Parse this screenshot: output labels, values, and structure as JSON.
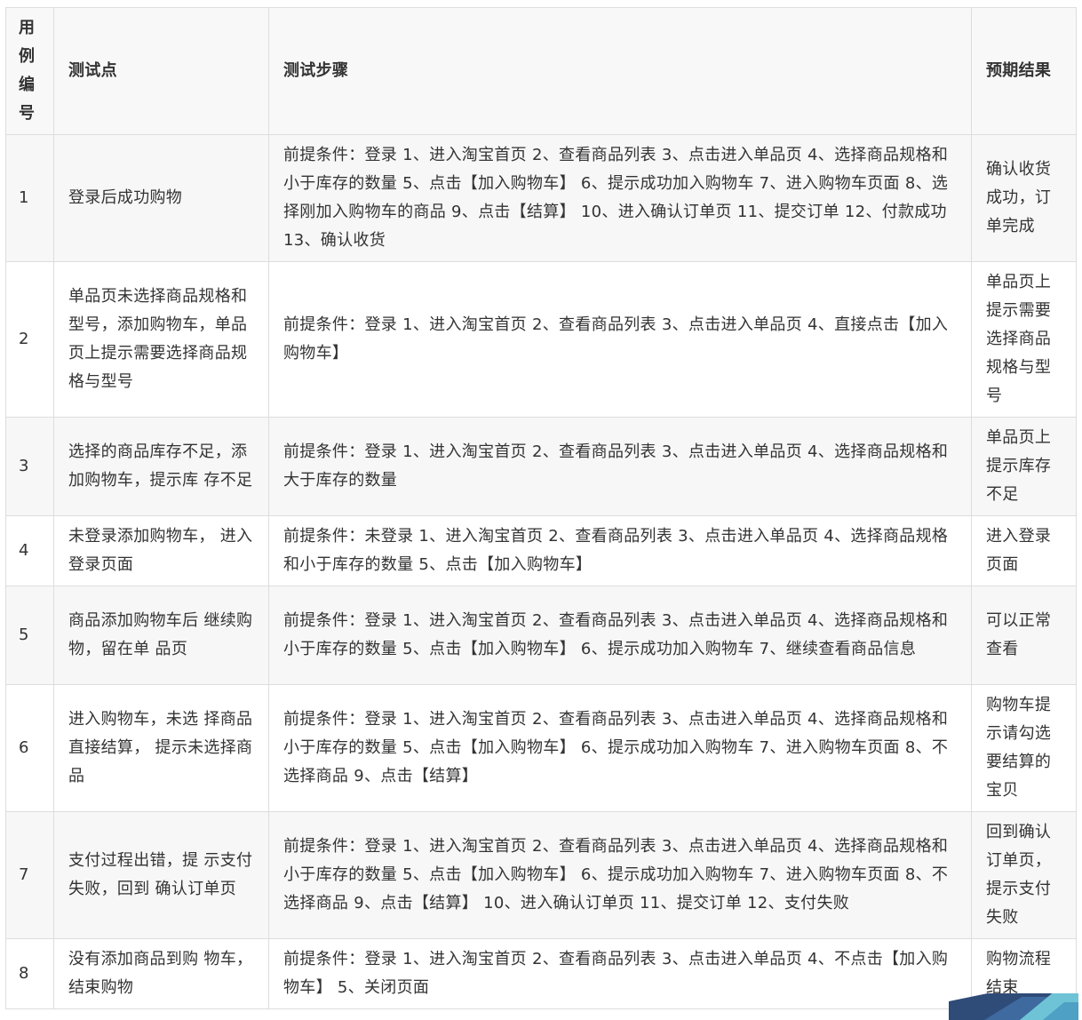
{
  "table": {
    "headers": {
      "id": "用例编号",
      "point": "测试点",
      "steps": "测试步骤",
      "result": "预期结果"
    },
    "rows": [
      {
        "id": "1",
        "point": "登录后成功购物",
        "steps": "前提条件：登录 1、进入淘宝首页 2、查看商品列表 3、点击进入单品页 4、选择商品规格和小于库存的数量 5、点击【加入购物车】 6、提示成功加入购物车 7、进入购物车页面 8、选择刚加入购物车的商品 9、点击【结算】 10、进入确认订单页 11、提交订单 12、付款成功 13、确认收货",
        "result": "确认收货成功，订单完成"
      },
      {
        "id": "2",
        "point": "单品页未选择商品规格和型号，添加购物车，单品页上提示需要选择商品规格与型号",
        "steps": "前提条件：登录 1、进入淘宝首页 2、查看商品列表 3、点击进入单品页 4、直接点击【加入购物车】",
        "result": "单品页上提示需要选择商品规格与型号"
      },
      {
        "id": "3",
        "point": "选择的商品库存不足，添加购物车，提示库 存不足",
        "steps": "前提条件：登录 1、进入淘宝首页 2、查看商品列表 3、点击进入单品页 4、选择商品规格和大于库存的数量",
        "result": "单品页上提示库存不足"
      },
      {
        "id": "4",
        "point": "未登录添加购物车， 进入登录页面",
        "steps": "前提条件：未登录 1、进入淘宝首页 2、查看商品列表 3、点击进入单品页 4、选择商品规格和小于库存的数量 5、点击【加入购物车】",
        "result": "进入登录页面"
      },
      {
        "id": "5",
        "point": "商品添加购物车后 继续购物，留在单 品页",
        "steps": "前提条件：登录 1、进入淘宝首页 2、查看商品列表 3、点击进入单品页 4、选择商品规格和小于库存的数量 5、点击【加入购物车】 6、提示成功加入购物车 7、继续查看商品信息",
        "result": "可以正常查看"
      },
      {
        "id": "6",
        "point": "进入购物车，未选 择商品直接结算， 提示未选择商品",
        "steps": "前提条件：登录 1、进入淘宝首页 2、查看商品列表 3、点击进入单品页 4、选择商品规格和小于库存的数量 5、点击【加入购物车】 6、提示成功加入购物车 7、进入购物车页面 8、不选择商品 9、点击【结算】",
        "result": "购物车提示请勾选要结算的宝贝"
      },
      {
        "id": "7",
        "point": "支付过程出错，提 示支付失败，回到 确认订单页",
        "steps": "前提条件：登录 1、进入淘宝首页 2、查看商品列表 3、点击进入单品页 4、选择商品规格和小于库存的数量 5、点击【加入购物车】 6、提示成功加入购物车 7、进入购物车页面 8、不选择商品 9、点击【结算】 10、进入确认订单页 11、提交订单 12、支付失败",
        "result": "回到确认订单页，提示支付失败"
      },
      {
        "id": "8",
        "point": "没有添加商品到购 物车，结束购物",
        "steps": "前提条件：登录 1、进入淘宝首页 2、查看商品列表 3、点击进入单品页 4、不点击【加入购物车】 5、关闭页面",
        "result": "购物流程结束"
      }
    ]
  }
}
